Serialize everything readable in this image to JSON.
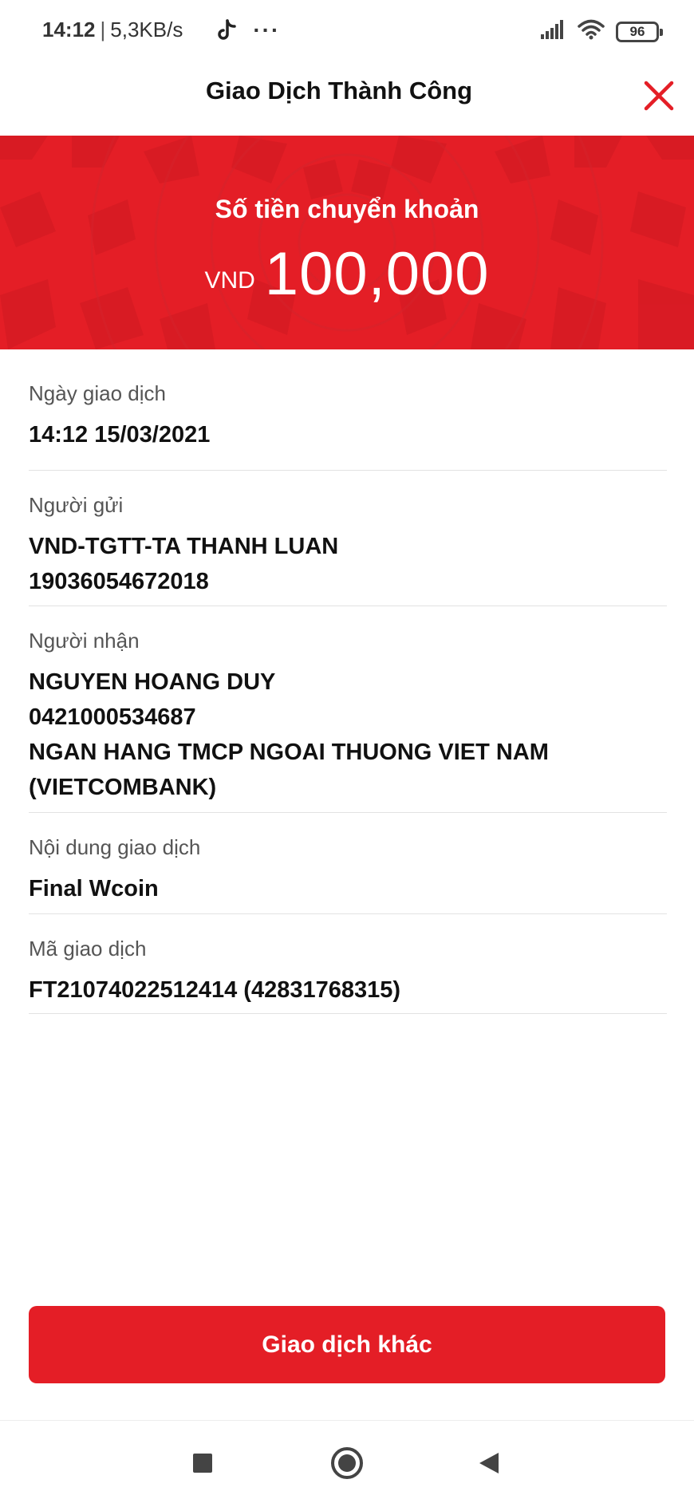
{
  "status_bar": {
    "time": "14:12",
    "separator": "|",
    "network_speed": "5,3KB/s",
    "more": "···",
    "battery_level": "96",
    "icons": [
      "tiktok-icon",
      "signal-icon",
      "wifi-icon",
      "battery-icon"
    ]
  },
  "header": {
    "title": "Giao Dịch Thành Công",
    "close_icon": "close-icon"
  },
  "banner": {
    "label": "Số tiền chuyển khoản",
    "currency": "VND",
    "amount": "100,000"
  },
  "details": {
    "date": {
      "label": "Ngày giao dịch",
      "value": "14:12 15/03/2021"
    },
    "sender": {
      "label": "Người gửi",
      "name": "VND-TGTT-TA THANH LUAN",
      "account": "19036054672018"
    },
    "receiver": {
      "label": "Người nhận",
      "name": "NGUYEN HOANG DUY",
      "account": "0421000534687",
      "bank": "NGAN HANG TMCP NGOAI THUONG VIET NAM",
      "bank_short": "(VIETCOMBANK)"
    },
    "content": {
      "label": "Nội dung giao dịch",
      "value": "Final Wcoin"
    },
    "code": {
      "label": "Mã giao dịch",
      "value": "FT21074022512414 (42831768315)"
    }
  },
  "action": {
    "label": "Giao dịch khác"
  },
  "nav": {
    "icons": [
      "square-icon",
      "circle-home-icon",
      "back-triangle-icon"
    ]
  },
  "colors": {
    "brand_red": "#e41e26",
    "pattern_dark": "#c8161e"
  }
}
